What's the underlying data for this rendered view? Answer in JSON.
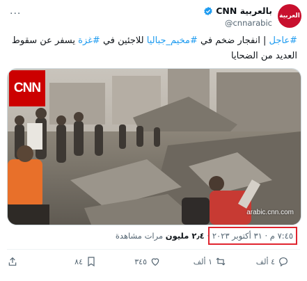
{
  "account": {
    "display_name": "CNN بالعربية",
    "handle": "@cnnarabic",
    "avatar_text": "العربية",
    "verified_color": "#1d9bf0"
  },
  "tweet": {
    "tag_breaking": "#عاجل",
    "sep": " | ",
    "t1": "انفجار ضخم في ",
    "tag_camp": "#مخيم_جباليا",
    "t2": " للاجئين في ",
    "tag_gaza": "#غزة",
    "t3": " يسفر عن سقوط العديد من الضحايا"
  },
  "media": {
    "logo_text": "CNN",
    "watermark": "arabic.cnn.com"
  },
  "meta": {
    "timestamp": "٧:٤٥ م · ٣١ أكتوبر ٢٠٢٣",
    "separator": " · ",
    "views_count": "٢٫٤ مليون",
    "views_label": " مرات مشاهدة"
  },
  "actions": {
    "reply_count": "٤ ألف",
    "retweet_count": "١ ألف",
    "like_count": "٣٤٥",
    "bookmark_count": "٨٤"
  }
}
